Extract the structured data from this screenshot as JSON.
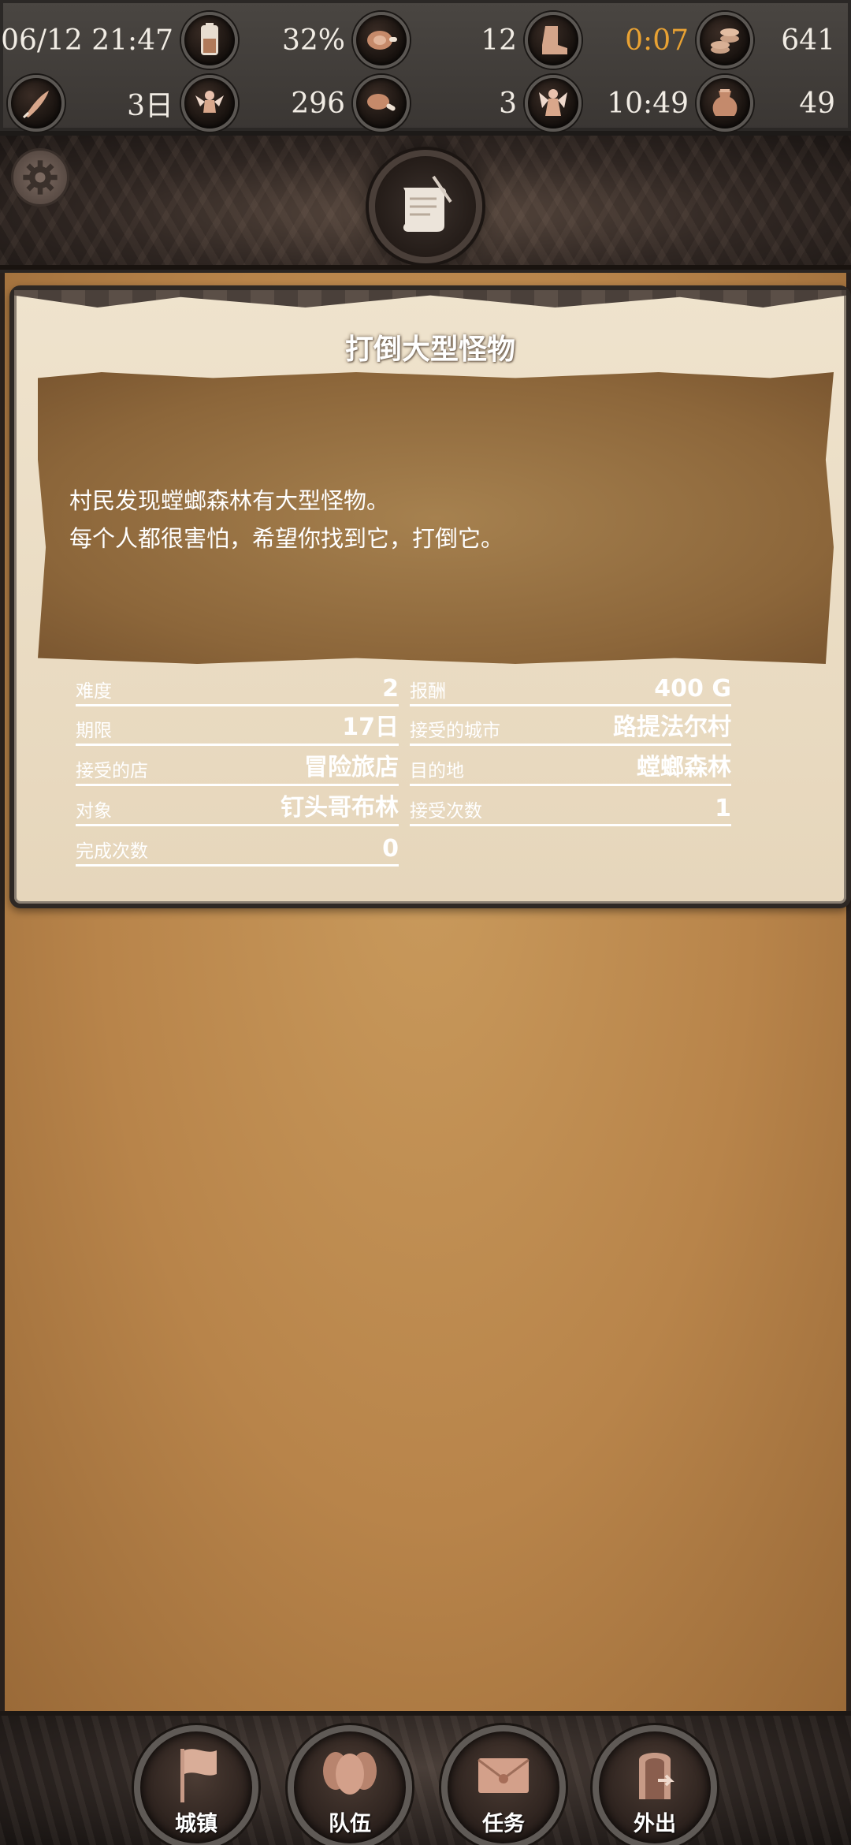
{
  "status": {
    "datetime": "06/12 21:47",
    "percent": "32%",
    "meat_count": "12",
    "boot_count": "12",
    "timer_orange": "0:07",
    "coins": "641",
    "days": "3日",
    "fairy_value": "296",
    "meat2_count": "3",
    "time2": "10:49",
    "pot_count": "49",
    "boot_label": "12"
  },
  "status_values": {
    "r1c2": "32%",
    "r1c3": "12",
    "r1c4": "0:07",
    "r1c5": "641",
    "r2c1": "3日",
    "r2c2": "296",
    "r2c3": "3",
    "r2c4": "10:49",
    "r2c5": "49"
  },
  "quest": {
    "title": "打倒大型怪物",
    "description_line1": "村民发现螳螂森林有大型怪物。",
    "description_line2": "每个人都很害怕，希望你找到它，打倒它。",
    "fields": {
      "difficulty_label": "难度",
      "difficulty_value": "2",
      "reward_label": "报酬",
      "reward_value": "400 G",
      "deadline_label": "期限",
      "deadline_value": "17日",
      "accepted_city_label": "接受的城市",
      "accepted_city_value": "路提法尔村",
      "accepted_shop_label": "接受的店",
      "accepted_shop_value": "冒险旅店",
      "destination_label": "目的地",
      "destination_value": "螳螂森林",
      "target_label": "对象",
      "target_value": "钉头哥布林",
      "accept_count_label": "接受次数",
      "accept_count_value": "1",
      "complete_count_label": "完成次数",
      "complete_count_value": "0"
    }
  },
  "nav": {
    "town": "城镇",
    "party": "队伍",
    "quest": "任务",
    "outing": "外出"
  },
  "colors": {
    "accent_orange": "#e9a233",
    "parchment": "#b8844a",
    "card_bg": "#efe3cd"
  },
  "icons": [
    "battery-icon",
    "meat-icon",
    "boot-icon",
    "coin-stack-icon",
    "quill-icon",
    "fairy-icon",
    "meat-bone-icon",
    "fairy-companion-icon",
    "pot-icon",
    "gear-icon",
    "scroll-icon",
    "flag-icon",
    "party-icon",
    "envelope-icon",
    "door-icon"
  ]
}
